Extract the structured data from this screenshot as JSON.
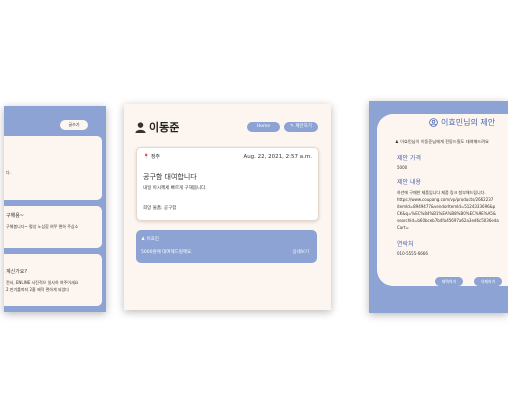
{
  "left_panel": {
    "write_button": "글쓰기",
    "card1_text": "다.",
    "card2_title": "구해용~",
    "card2_text": "구해봅니다~ 평상 노심힘 여쭈 편하 주심소",
    "card3_title": "계신가요?",
    "card3_line1": "전서, ENLINE 사진적으 일사하 여주이세요",
    "card3_line2": "2 만기를까지 2훔 제작 편하게 되었다"
  },
  "center_panel": {
    "user_name": "이동준",
    "home_button": "Home",
    "suggest_button": "제안하기",
    "post": {
      "location": "정주",
      "date": "Aug. 22, 2021, 2:57 a.m.",
      "title": "공구함 대여합니다",
      "body": "내일 아시께세 빠르게 구해봅니다.",
      "wanted": "희망 물품: 공구함"
    },
    "reply": {
      "user": "이효민",
      "text": "5000원에 대여해드릴께요.",
      "detail_button": "상세보기"
    }
  },
  "right_panel": {
    "title": "이효민님의 제안",
    "user_line": "이효민님이 이동준님에게 전동드릴도 대여해드려요",
    "price_label": "제안 가격",
    "price_value": "5000",
    "content_label": "제안 내용",
    "content_lines": [
      "하년에 구매한 제품입니다 제품 링크 첨부해드립니다.",
      "https://www.coupang.com/vp/products/2662237",
      "itemId=8949477&vendorItemId=5124333696&p",
      "CK&q=%EC%84%B1%EA%B8%B0%EC%9E%A5&",
      "searchId=b60bceb7b4fa45697a62a3ed6c5036eda",
      "Cart="
    ],
    "contact_label": "연락처",
    "contact_value": "010-5555-6666",
    "accept_button": "채택하기",
    "delete_button": "삭제하기"
  }
}
